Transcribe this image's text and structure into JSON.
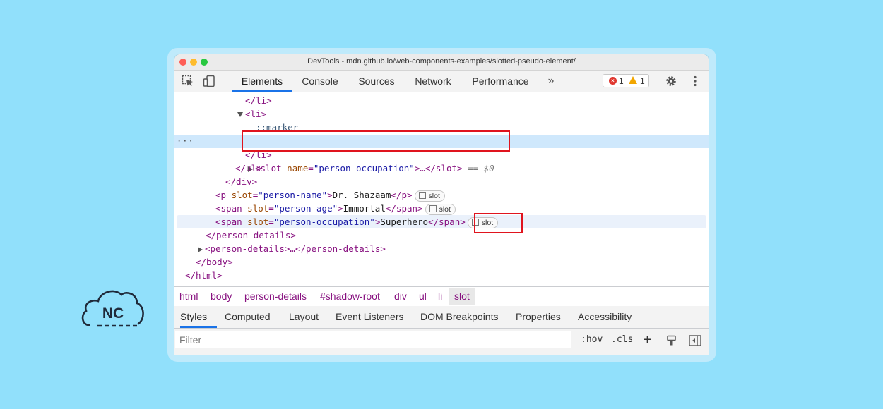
{
  "window": {
    "title": "DevTools - mdn.github.io/web-components-examples/slotted-pseudo-element/"
  },
  "toolbar": {
    "tabs": [
      "Elements",
      "Console",
      "Sources",
      "Network",
      "Performance"
    ],
    "more": "»",
    "errors": "1",
    "warnings": "1"
  },
  "dom": {
    "l1": "</li>",
    "l2_tag": "<li>",
    "l3": "::marker",
    "l4_open": "<slot",
    "l4_attr": "name",
    "l4_eq": "=",
    "l4_val": "\"person-occupation\"",
    "l4_close": ">…</slot>",
    "l4_dollar": "== $0",
    "l5": "</li>",
    "l6": "</ul>",
    "l7": "</div>",
    "l8_open": "<p",
    "l8_attr": "slot",
    "l8_val": "\"person-name\"",
    "l8_gt": ">",
    "l8_text": "Dr. Shazaam",
    "l8_close": "</p>",
    "l9_open": "<span",
    "l9_attr": "slot",
    "l9_val": "\"person-age\"",
    "l9_gt": ">",
    "l9_text": "Immortal",
    "l9_close": "</span>",
    "l10_open": "<span",
    "l10_attr": "slot",
    "l10_val": "\"person-occupation\"",
    "l10_gt": ">",
    "l10_text": "Superhero",
    "l10_close": "</span>",
    "l11": "</person-details>",
    "l12": "<person-details>…</person-details>",
    "l13": "</body>",
    "l14": "</html>",
    "badge": "slot",
    "ellipsis": "···"
  },
  "breadcrumbs": [
    "html",
    "body",
    "person-details",
    "#shadow-root",
    "div",
    "ul",
    "li",
    "slot"
  ],
  "subtabs": [
    "Styles",
    "Computed",
    "Layout",
    "Event Listeners",
    "DOM Breakpoints",
    "Properties",
    "Accessibility"
  ],
  "filter": {
    "placeholder": "Filter",
    "hov": ":hov",
    "cls": ".cls",
    "plus": "+"
  },
  "logo": {
    "text": "NC"
  },
  "colors": {
    "background": "#91e0fb",
    "accent": "#1a73e8",
    "highlight": "#e0141e",
    "selected_row": "#cfe8fc"
  }
}
